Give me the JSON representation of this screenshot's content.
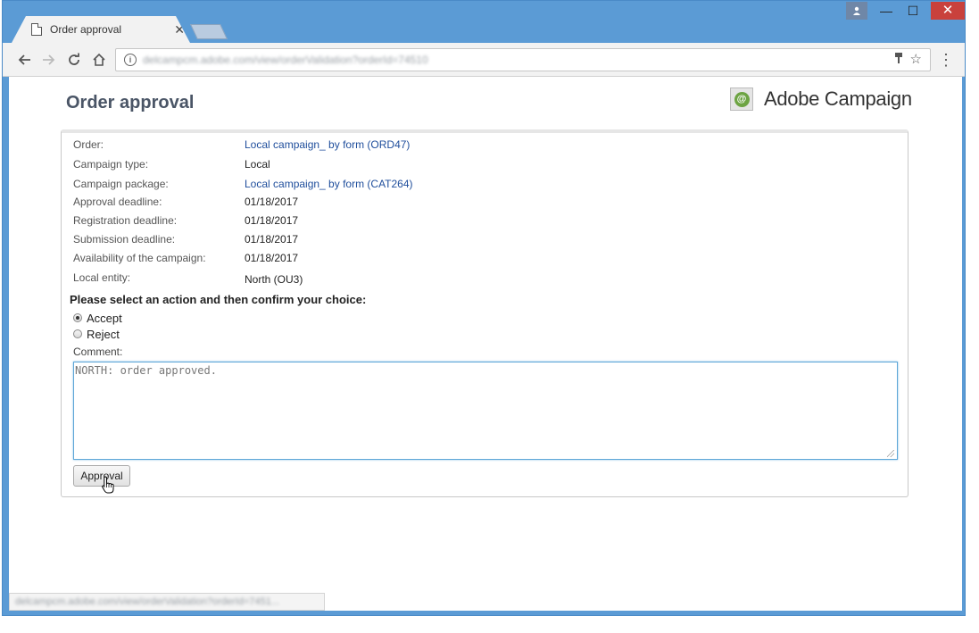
{
  "browser": {
    "tab_title": "Order approval",
    "tab_close": "✕",
    "url": "delcampcm.adobe.com/view/orderValidation?orderId=74510",
    "status_url": "delcampcm.adobe.com/view/orderValidation?orderId=7451...",
    "window_controls": {
      "minimize": "—",
      "maximize": "☐",
      "close": "✕"
    }
  },
  "page": {
    "title": "Order approval",
    "brand": "Adobe Campaign",
    "details": [
      {
        "label": "Order:",
        "value": "Local campaign_ by form (ORD47)",
        "link": true
      },
      {
        "label": "Campaign type:",
        "value": "Local",
        "link": false
      },
      {
        "label": "Campaign package:",
        "value": "Local campaign_ by form (CAT264)",
        "link": true
      },
      {
        "label": "Approval deadline:",
        "value": "01/18/2017",
        "link": false
      },
      {
        "label": "Registration deadline:",
        "value": "01/18/2017",
        "link": false
      },
      {
        "label": "Submission deadline:",
        "value": "01/18/2017",
        "link": false
      },
      {
        "label": "Availability of the campaign:",
        "value": "01/18/2017",
        "link": false
      },
      {
        "label": "Local entity:",
        "value": "North (OU3)",
        "link": false
      }
    ],
    "prompt": "Please select an action and then confirm your choice:",
    "actions": [
      {
        "label": "Accept",
        "checked": true
      },
      {
        "label": "Reject",
        "checked": false
      }
    ],
    "comment_label": "Comment:",
    "comment_value": "NORTH: order approved.",
    "submit_label": "Approval"
  },
  "colors": {
    "window_frame": "#5b9bd5",
    "link": "#1f4e9c",
    "title": "#4a5566",
    "close_button": "#c9413c",
    "focus_ring": "#5ea7d8"
  },
  "icons": [
    "page-icon",
    "close-icon",
    "back-arrow-icon",
    "forward-arrow-icon",
    "reload-icon",
    "home-icon",
    "info-icon",
    "key-icon",
    "star-icon",
    "menu-icon",
    "user-icon",
    "adobe-campaign-logo-icon",
    "hand-cursor-icon"
  ]
}
